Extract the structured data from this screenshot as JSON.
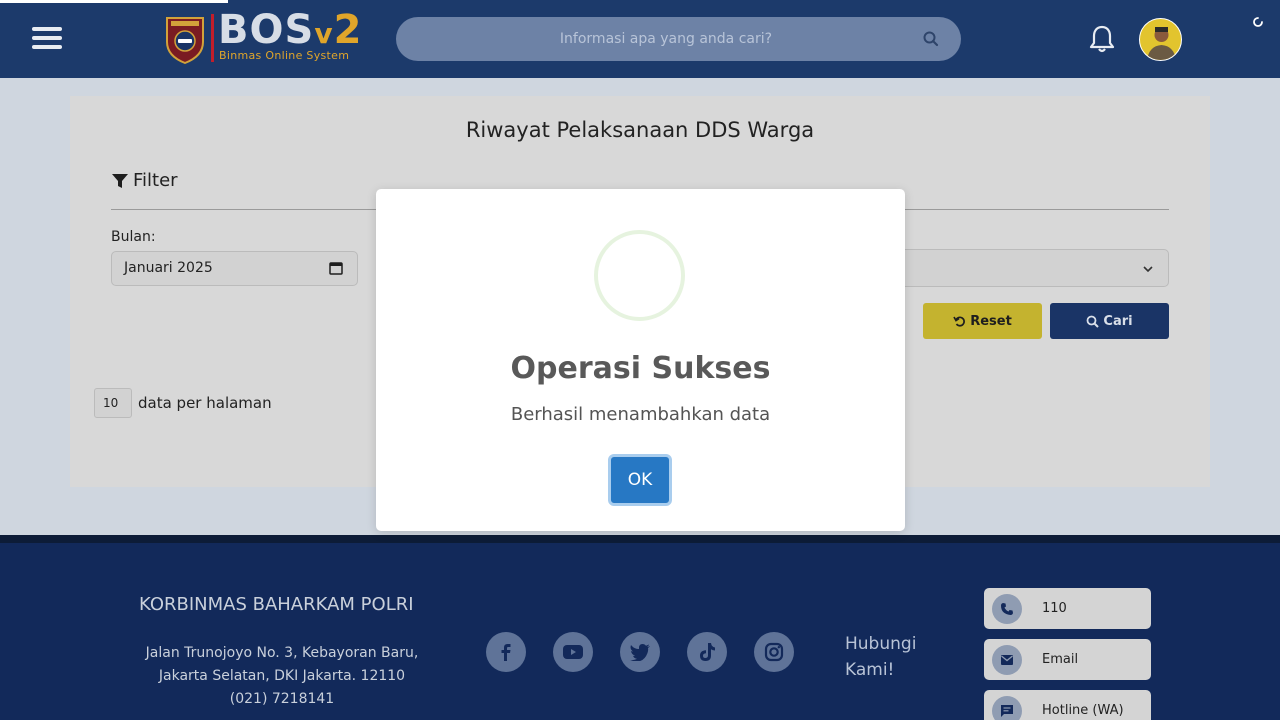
{
  "header": {
    "logo_main": "BOS",
    "logo_version_v": "v",
    "logo_version_num": "2",
    "logo_sub": "Binmas Online System",
    "search_placeholder": "Informasi apa yang anda cari?"
  },
  "card": {
    "title": "Riwayat Pelaksanaan DDS Warga",
    "filter_label": "Filter",
    "bulan_label": "Bulan:",
    "bulan_value": "Januari 2025",
    "reset_label": "Reset",
    "cari_label": "Cari",
    "perpage_value": "10",
    "perpage_label": "data per halaman"
  },
  "modal": {
    "title": "Operasi Sukses",
    "message": "Berhasil menambahkan data",
    "ok_label": "OK"
  },
  "footer": {
    "org": "KORBINMAS BAHARKAM POLRI",
    "address": "Jalan Trunojoyo No. 3, Kebayoran Baru, Jakarta Selatan, DKI Jakarta. 12110 (021) 7218141",
    "hubungi": "Hubungi Kami!",
    "contacts": [
      {
        "label": "110",
        "icon": "phone-icon"
      },
      {
        "label": "Email",
        "icon": "email-icon"
      },
      {
        "label": "Hotline (WA)",
        "icon": "chat-icon"
      }
    ],
    "social_icons": [
      "facebook-icon",
      "youtube-icon",
      "twitter-icon",
      "tiktok-icon",
      "instagram-icon"
    ]
  },
  "colors": {
    "header_bg": "#1c3a6b",
    "footer_bg": "#12295a",
    "accent_gold": "#e0a52a",
    "ok_button": "#2778c4",
    "reset_button": "#c4b32f",
    "cari_button": "#1a3466"
  }
}
